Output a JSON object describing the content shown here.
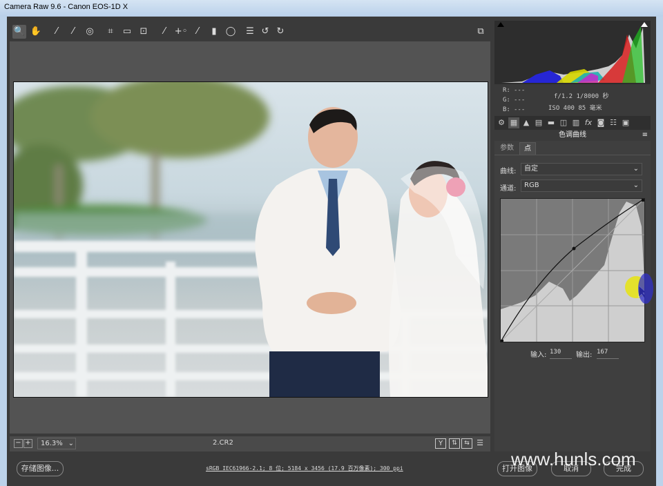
{
  "window": {
    "title": "Camera Raw 9.6 -  Canon EOS-1D X"
  },
  "toolbar": {
    "tools": [
      "zoom-icon",
      "hand-icon",
      "white-balance-icon",
      "color-sampler-icon",
      "targeted-adjust-icon",
      "crop-icon",
      "straighten-icon",
      "transform-icon",
      "spot-removal-icon",
      "red-eye-icon",
      "adjustment-brush-icon",
      "graduated-filter-icon",
      "radial-filter-icon",
      "preferences-icon",
      "rotate-ccw-icon",
      "rotate-cw-icon"
    ],
    "glyphs": [
      "🔍",
      "✋",
      "⁄",
      "⁄",
      "◎",
      "⌗",
      "▭",
      "⊡",
      "⁄",
      "+◦",
      "⁄",
      "▮",
      "◯",
      "☰",
      "↺",
      "↻"
    ],
    "fullscreen_glyph": "⧉"
  },
  "status": {
    "zoom": "16.3%",
    "filename": "2.CR2",
    "workflow": "sRGB IEC61966-2.1; 8 位; 5184 x 3456 (17.9 百万像素); 300 ppi"
  },
  "info": {
    "r_label": "R:",
    "r_value": "---",
    "g_label": "G:",
    "g_value": "---",
    "b_label": "B:",
    "b_value": "---",
    "aperture_shutter": "f/1.2  1/8000 秒",
    "iso_focal": "ISO 400  85 毫米"
  },
  "panel": {
    "tab_glyphs": [
      "⚙",
      "▦",
      "▲",
      "▤",
      "▬",
      "◫",
      "▥",
      "fx",
      "◙",
      "☷",
      "▣"
    ],
    "title": "色调曲线",
    "subtabs": [
      "参数",
      "点"
    ],
    "curve_label": "曲线:",
    "curve_value": "自定",
    "channel_label": "通道:",
    "channel_value": "RGB",
    "input_label": "输入:",
    "input_value": "130",
    "output_label": "输出:",
    "output_value": "167"
  },
  "buttons": {
    "save": "存储图像...",
    "open": "打开图像",
    "cancel": "取消",
    "done": "完成"
  },
  "watermark": "www.hunls.com"
}
